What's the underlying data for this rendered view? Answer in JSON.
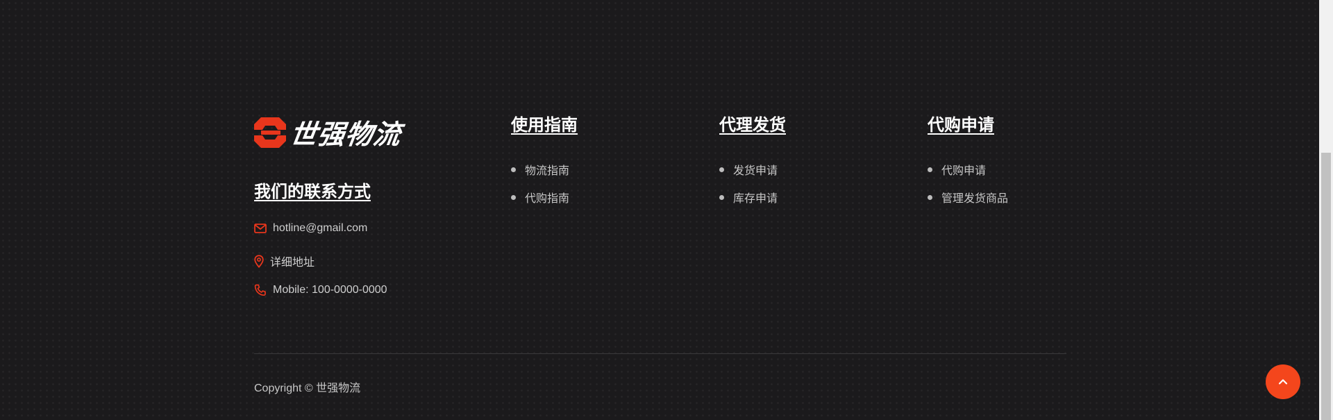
{
  "brand": {
    "name": "世强物流",
    "accent_color": "#e8361c"
  },
  "contact": {
    "heading": "我们的联系方式",
    "email": "hotline@gmail.com",
    "address": "详细地址",
    "mobile": "Mobile: 100-0000-0000"
  },
  "columns": [
    {
      "heading": "使用指南",
      "items": [
        "物流指南",
        "代购指南"
      ]
    },
    {
      "heading": "代理发货",
      "items": [
        "发货申请",
        "库存申请"
      ]
    },
    {
      "heading": "代购申请",
      "items": [
        "代购申请",
        "管理发货商品"
      ]
    }
  ],
  "footer": {
    "copyright": "Copyright © 世强物流"
  },
  "back_to_top": {
    "icon": "chevron-up-icon",
    "color": "#f4461c"
  }
}
